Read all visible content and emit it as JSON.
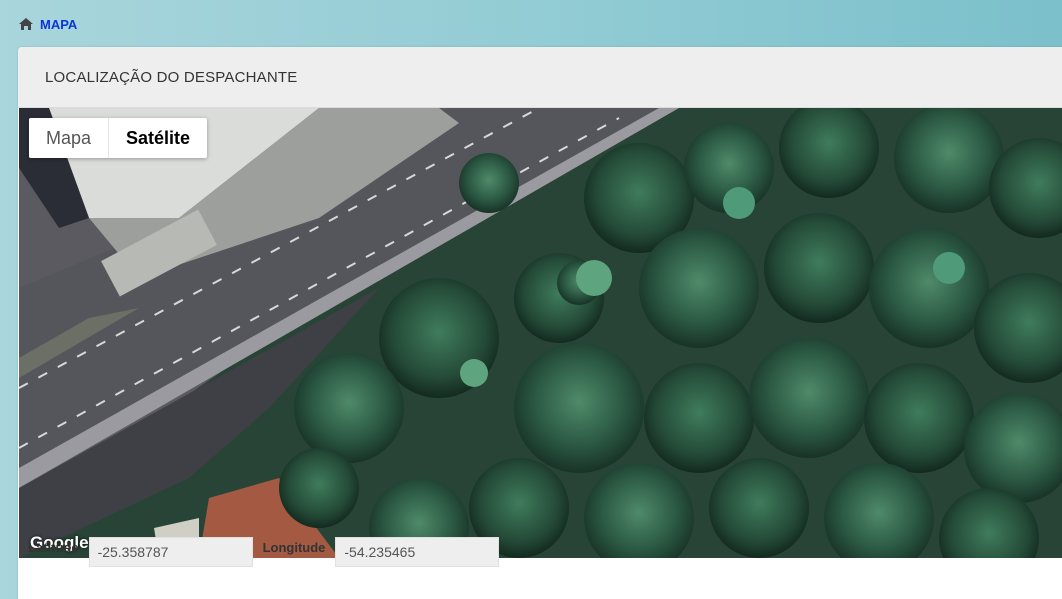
{
  "breadcrumb": {
    "icon": "home-icon",
    "label": "MAPA"
  },
  "panel": {
    "title": "LOCALIZAÇÃO DO DESPACHANTE"
  },
  "map": {
    "type_buttons": {
      "map_label": "Mapa",
      "satellite_label": "Satélite",
      "selected": "Satélite"
    },
    "logo": "Google"
  },
  "coordinates": {
    "latitude_label": "Latitude",
    "latitude_value": "-25.358787",
    "longitude_label": "Longitude",
    "longitude_value": "-54.235465"
  },
  "colors": {
    "link": "#0b35d6",
    "header_bg": "#eeeeee",
    "page_bg": "#93ccd4"
  }
}
